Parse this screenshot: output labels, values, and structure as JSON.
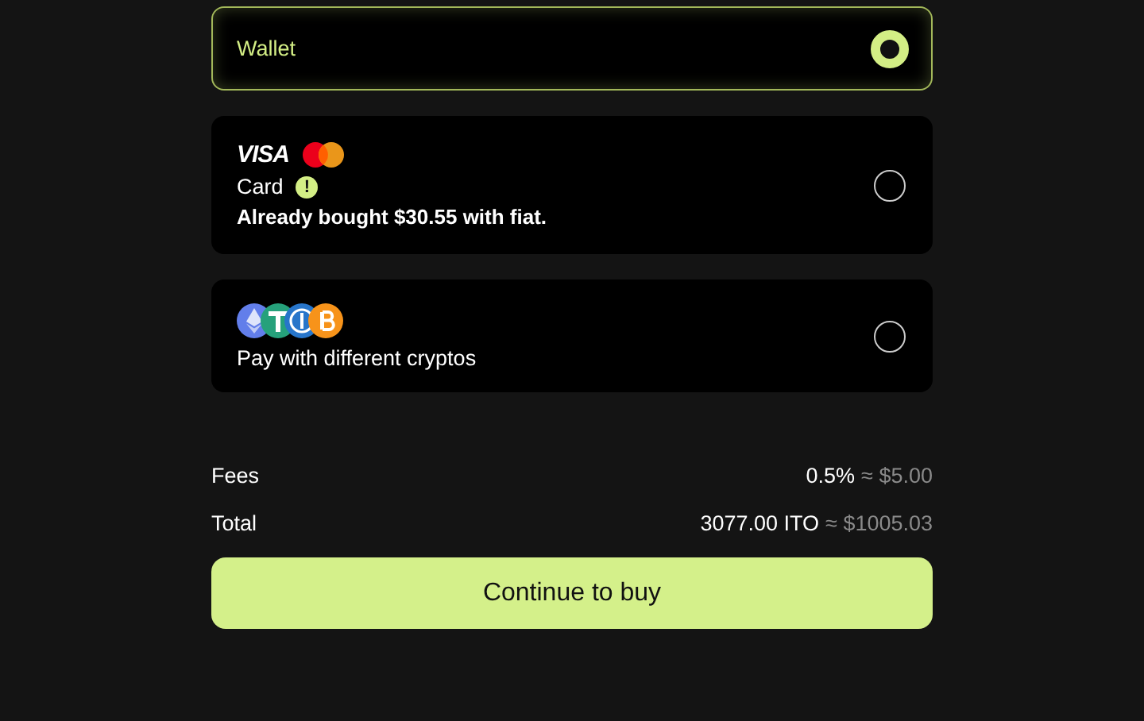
{
  "options": [
    {
      "kind": "wallet",
      "label": "Wallet",
      "selected": true
    },
    {
      "kind": "card",
      "brand": "VISA",
      "label": "Card",
      "warning": "!",
      "note": "Already bought $30.55 with fiat.",
      "selected": false
    },
    {
      "kind": "crypto",
      "label": "Pay with different cryptos",
      "selected": false
    }
  ],
  "summary": [
    {
      "label": "Fees",
      "value": "0.5%",
      "approx": "≈ $5.00"
    },
    {
      "label": "Total",
      "value": "3077.00 ITO",
      "approx": "≈ $1005.03"
    }
  ],
  "button": "Continue to buy"
}
